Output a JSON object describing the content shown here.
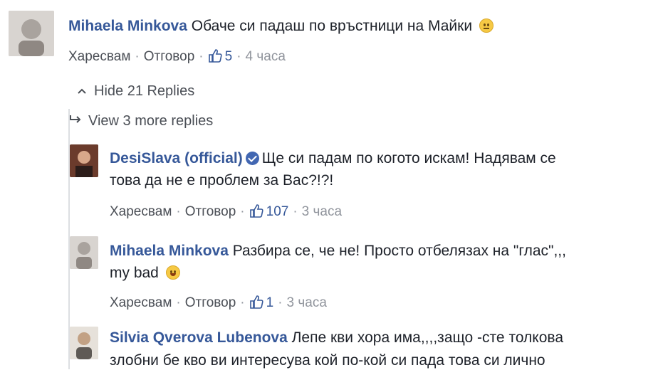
{
  "comments": [
    {
      "name": "Mihaela Minkova",
      "text": "Обаче си падаш по връстници на Майки",
      "emoji": "neutral-face-emoji",
      "like_label": "Харесвам",
      "reply_label": "Отговор",
      "likes": "5",
      "time": "4 часа"
    }
  ],
  "replies_toggle": {
    "hide_label": "Hide 21 Replies",
    "more_label": "View 3 more replies"
  },
  "replies": [
    {
      "name": "DesiSlava (official)",
      "verified": true,
      "text_line1": "Ще си падам по когото искам! Надявам се",
      "text_line2": "това да не е проблем за Вас?!?!",
      "like_label": "Харесвам",
      "reply_label": "Отговор",
      "likes": "107",
      "time": "3 часа"
    },
    {
      "name": "Mihaela Minkova",
      "text_line1": "Разбира се, че не! Просто отбелязах на \"глас\",,,",
      "text_line2": "my bad",
      "emoji": "grinning-face-emoji",
      "like_label": "Харесвам",
      "reply_label": "Отговор",
      "likes": "1",
      "time": "3 часа"
    },
    {
      "name": "Silvia Qverova Lubenova",
      "text_line1": "Лепе кви хора има,,,,защо -сте толкова",
      "text_line2": "злобни бе кво ви интересува кой по-кой си пада това си лично"
    }
  ],
  "colors": {
    "name_blue": "#365899",
    "meta_gray": "#90949c",
    "verified_blue": "#4267b2"
  }
}
